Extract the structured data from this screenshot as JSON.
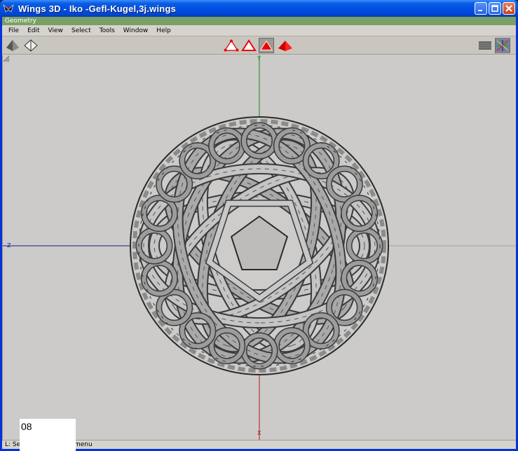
{
  "window": {
    "title": "Wings 3D - Iko -Gefl-Kugel,3j.wings"
  },
  "geometry_bar": {
    "label": "Geometry"
  },
  "menu": {
    "items": [
      "File",
      "Edit",
      "View",
      "Select",
      "Tools",
      "Window",
      "Help"
    ]
  },
  "toolbar": {
    "left_icons": [
      "smooth-shaded-icon",
      "wireframe-icon"
    ],
    "selection_modes": [
      "vertex-mode-icon",
      "edge-mode-icon",
      "face-mode-icon",
      "body-mode-icon"
    ],
    "active_mode": "face-mode-icon",
    "right_icons": [
      "ground-plane-icon",
      "axes-icon"
    ]
  },
  "viewport": {
    "axis_labels": {
      "y": "Y",
      "z": "Z",
      "x": "X"
    },
    "colors": {
      "background": "#cccbc9",
      "y_axis": "#1a8a1a",
      "z_axis": "#1a1a9a",
      "x_axis": "#b01818",
      "mesh": "#8e8e8e"
    }
  },
  "status": {
    "text": "L: Se... mera   R: Show menu"
  },
  "overlay": {
    "fps": "08"
  }
}
